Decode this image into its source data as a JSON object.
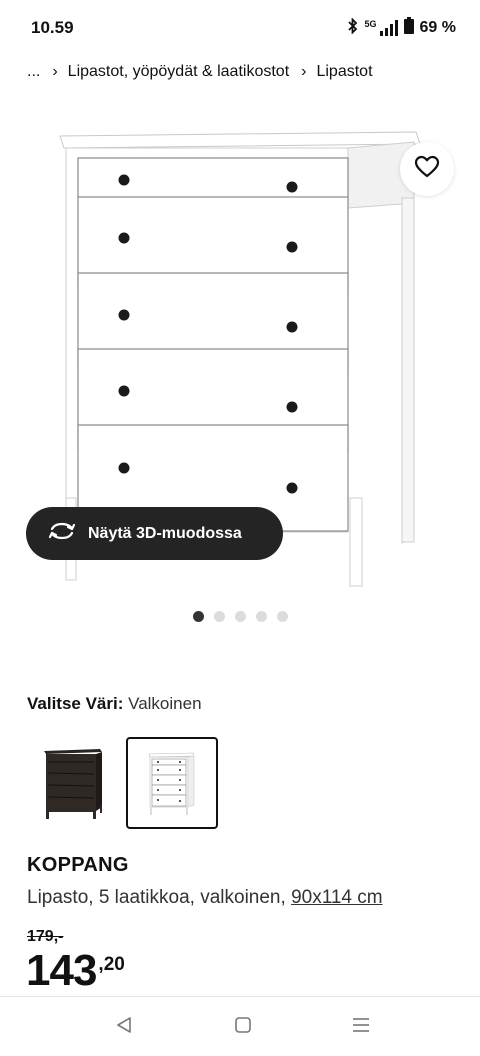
{
  "status_bar": {
    "time": "10.59",
    "network": "5G",
    "battery": "69 %"
  },
  "breadcrumb": {
    "ellipsis": "...",
    "items": [
      "Lipastot, yöpöydät & laatikostot",
      "Lipastot"
    ]
  },
  "image": {
    "view3d_label": "Näytä 3D-muodossa",
    "dot_count": 5,
    "active_dot": 0
  },
  "color": {
    "label": "Valitse Väri:",
    "value": "Valkoinen",
    "options": [
      {
        "name": "black-brown",
        "selected": false
      },
      {
        "name": "white",
        "selected": true
      }
    ]
  },
  "product": {
    "name": "KOPPANG",
    "description": "Lipasto, 5 laatikkoa, valkoinen, ",
    "dimensions": "90x114 cm",
    "old_price": "179,-",
    "price_integer": "143",
    "price_decimal": ",20"
  },
  "icons": {
    "favorite": "heart-icon",
    "view3d": "rotate-3d-icon",
    "nav_back": "triangle-back-icon",
    "nav_home": "square-home-icon",
    "nav_recent": "lines-recent-icon"
  }
}
